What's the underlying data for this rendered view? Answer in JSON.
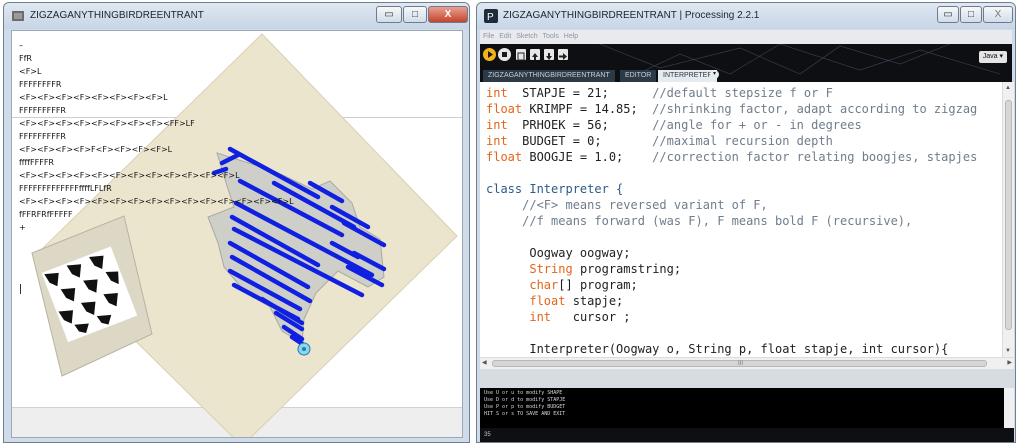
{
  "left_window": {
    "title": "ZIGZAGANYTHINGBIRDREENTRANT",
    "buttons": {
      "minimize": "▭",
      "maximize": "□",
      "close": "X"
    },
    "lines": [
      "–",
      "FfR",
      "<F>L",
      "FFFFFFFFR",
      "<F><F><F><F><F><F><F><F>L",
      "FFFFFFFFFR",
      "<F><F><F><F><F><F><F><F><FF>LF",
      "FFFFFFFFFR",
      "<F><F><F><F>F<F><F><F><F>L",
      "ffffFFFFR",
      "<F><F><F><F><F><F><F><F><F><F><F><F>L",
      "FFFFFFFFFFFFFffffLFLfR",
      "<F><F><F><F><F><F><F><F><F><F><F><F><F><F><F>L",
      "fFFRFRfFFFFF",
      "+"
    ],
    "stroke_color": "#1020e0"
  },
  "right_window": {
    "title": "ZIGZAGANYTHINGBIRDREENTRANT | Processing 2.2.1",
    "menu": [
      "File",
      "Edit",
      "Sketch",
      "Tools",
      "Help"
    ],
    "mode": "Java ▾",
    "tabs": [
      "ZIGZAGANYTHINGBIRDREENTRANT",
      "EDITOR",
      "INTERPRETER"
    ],
    "active_tab": "INTERPRETER",
    "code": {
      "l1": {
        "type": "int",
        "rest": "  STAPJE = 21;",
        "comment": "      //default stepsize f or F"
      },
      "l2": {
        "type": "float",
        "rest": " KRIMPF = 14.85;",
        "comment": "  //shrinking factor, adapt according to zigzag"
      },
      "l3": {
        "type": "int",
        "rest": "  PRHOEK = 56;",
        "comment": "      //angle for + or - in degrees"
      },
      "l4": {
        "type": "int",
        "rest": "  BUDGET = 0;",
        "comment": "       //maximal recursion depth"
      },
      "l5": {
        "type": "float",
        "rest": " BOOGJE = 1.0;",
        "comment": "    //correction factor relating boogjes, stapjes"
      },
      "l6": "class Interpreter {",
      "l7": "     //<F> means reversed variant of F,",
      "l8": "     //f means forward (was F), F means bold F (recursive),",
      "l9": "      Oogway oogway;",
      "l10": {
        "type": "String",
        "rest": " programstring;"
      },
      "l11": {
        "type": "char",
        "rest": "[] program;"
      },
      "l12": {
        "type": "float",
        "rest": " stapje;"
      },
      "l13": {
        "type": "int",
        "rest": "   cursor ;"
      },
      "l14": "      Interpreter(Oogway o, String p, float stapje, int cursor){"
    },
    "hscroll_grip": "III",
    "console_lines": [
      "Use U or u to modify SHAPE",
      "Use D or d to modify STAPJE",
      "Use P or p to modify BUDGET",
      "HIT S or s TO SAVE AND EXIT"
    ],
    "status": "35",
    "colors": {
      "keyword": "#e2661a",
      "comment": "#6f7d8c",
      "toolbar": "#0d0f12"
    }
  }
}
